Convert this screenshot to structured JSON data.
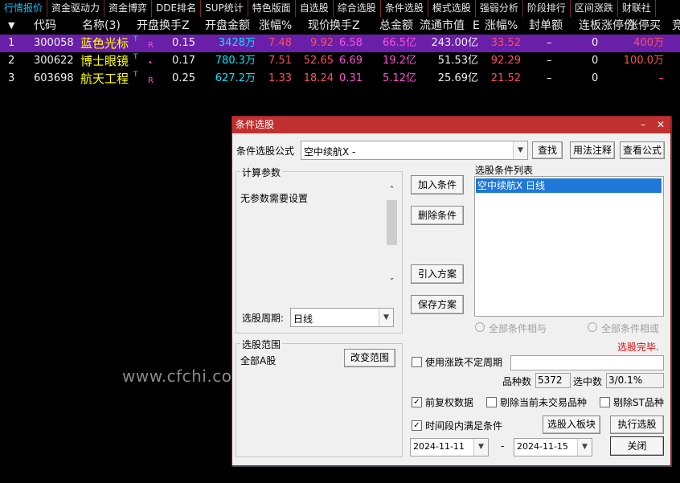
{
  "tabs": [
    "行情报价",
    "资金驱动力",
    "资金博弈",
    "DDE排名",
    "SUP统计",
    "特色版面",
    "自选股",
    "综合选股",
    "条件选股",
    "模式选股",
    "强弱分析",
    "阶段排行",
    "区间涨跌",
    "财联社"
  ],
  "header": {
    "arrow": "▼",
    "cols": [
      "代码",
      "名称(3)",
      "开盘换手Z",
      "开盘金额",
      "涨幅%",
      "现价",
      "换手Z",
      "总金额",
      "流通市值",
      "E",
      "涨幅%",
      "封单额",
      "连板",
      "涨停价",
      "涨停买",
      "竞"
    ]
  },
  "rows": [
    {
      "idx": "1",
      "code": "300058",
      "name": "蓝色光标",
      "t": "T",
      "r": "R",
      "open_turn": "0.15",
      "open_amt": "3428万",
      "chg": "7.48",
      "price": "9.92",
      "turn": "6.58",
      "amt": "66.5亿",
      "cap": "243.00亿",
      "e_chg": "33.52",
      "seal": "–",
      "lian": "0",
      "buy": "400万"
    },
    {
      "idx": "2",
      "code": "300622",
      "name": "博士眼镜",
      "t": "T",
      "r": "•",
      "open_turn": "0.17",
      "open_amt": "780.3万",
      "chg": "7.51",
      "price": "52.65",
      "turn": "6.69",
      "amt": "19.2亿",
      "cap": "51.53亿",
      "e_chg": "92.29",
      "seal": "–",
      "lian": "0",
      "buy": "100.0万"
    },
    {
      "idx": "3",
      "code": "603698",
      "name": "航天工程",
      "t": "T",
      "r": "R",
      "open_turn": "0.25",
      "open_amt": "627.2万",
      "chg": "1.33",
      "price": "18.24",
      "turn": "0.31",
      "amt": "5.12亿",
      "cap": "25.69亿",
      "e_chg": "21.52",
      "seal": "–",
      "lian": "0",
      "buy": "–"
    }
  ],
  "watermark": "www.cfchi.com",
  "dialog": {
    "title": "条件选股",
    "min_glyph": "–",
    "close_glyph": "✕",
    "formula_label": "条件选股公式",
    "formula_value": "空中续航X  -",
    "btn_query": "查找",
    "btn_usage": "用法注释",
    "btn_view": "查看公式",
    "params_title": "计算参数",
    "params_text": "无参数需要设置",
    "period_label": "选股周期:",
    "period_value": "日线",
    "btn_add": "加入条件",
    "btn_delete": "删除条件",
    "btn_import": "引入方案",
    "btn_save": "保存方案",
    "list_title": "选股条件列表",
    "list_items": [
      "空中续航X  日线"
    ],
    "radio_and": "全部条件相与",
    "radio_or": "全部条件相或",
    "status": "选股完毕.",
    "scope_title": "选股范围",
    "scope_value": "全部A股",
    "btn_scope": "改变范围",
    "uncertain_label": "使用涨跌不定周期",
    "count_label": "品种数",
    "count_value": "5372",
    "selected_label": "选中数",
    "selected_value": "3/0.1%",
    "chk_pre": "前复权数据",
    "chk_pre_checked": true,
    "chk_untraded": "剔除当前未交易品种",
    "chk_st": "剔除ST品种",
    "chk_time": "时间段内满足条件",
    "chk_time_checked": true,
    "btn_to_board": "选股入板块",
    "btn_execute": "执行选股",
    "date_from": "2024-11-11",
    "date_to": "2024-11-15",
    "dash": "-",
    "btn_close": "关闭"
  }
}
